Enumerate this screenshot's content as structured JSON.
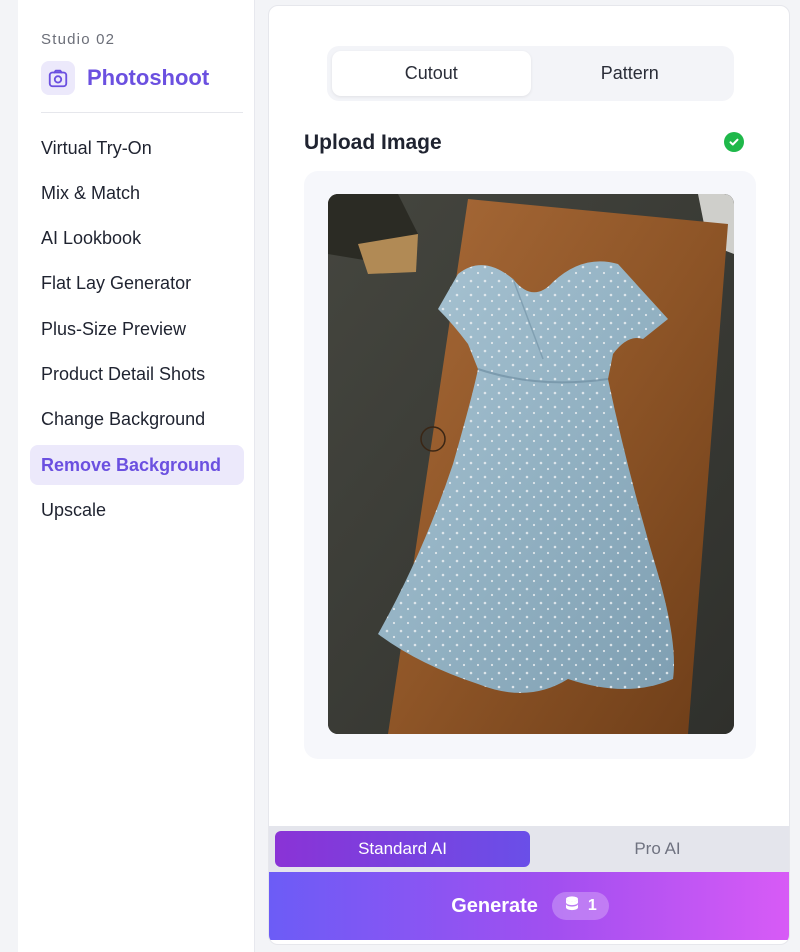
{
  "sidebar": {
    "studio_label": "Studio 02",
    "brand_title": "Photoshoot",
    "brand_icon": "camera-icon",
    "items": [
      {
        "label": "Virtual Try-On",
        "active": false
      },
      {
        "label": "Mix & Match",
        "active": false
      },
      {
        "label": "AI Lookbook",
        "active": false
      },
      {
        "label": "Flat Lay Generator",
        "active": false
      },
      {
        "label": "Plus-Size Preview",
        "active": false
      },
      {
        "label": "Product Detail Shots",
        "active": false
      },
      {
        "label": "Change Background",
        "active": false
      },
      {
        "label": "Remove Background",
        "active": true
      },
      {
        "label": "Upscale",
        "active": false
      }
    ]
  },
  "main": {
    "tabs": [
      {
        "label": "Cutout",
        "active": true
      },
      {
        "label": "Pattern",
        "active": false
      }
    ],
    "upload_title": "Upload Image",
    "upload_status_icon": "check-circle-icon",
    "modes": [
      {
        "label": "Standard AI",
        "active": true
      },
      {
        "label": "Pro AI",
        "active": false
      }
    ],
    "generate": {
      "label": "Generate",
      "credit_icon": "coins-stack-icon",
      "credit_count": "1"
    }
  },
  "colors": {
    "accent": "#6b50e0",
    "accent_soft": "#ece9fb",
    "success": "#1fb84a",
    "generate_start": "#6c5cf6",
    "generate_end": "#d85bf6"
  }
}
